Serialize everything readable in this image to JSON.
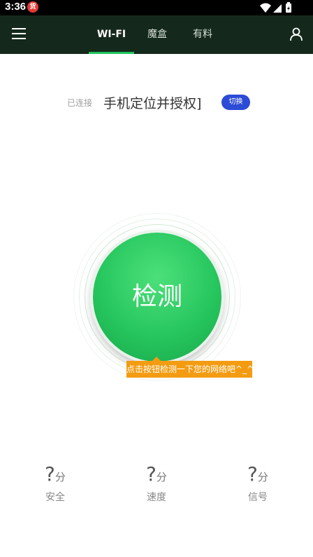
{
  "status_bar": {
    "time": "3:36",
    "badge_text": "货"
  },
  "app_bar": {
    "tabs": [
      {
        "label": "WI-FI",
        "active": true
      },
      {
        "label": "魔盒",
        "active": false
      },
      {
        "label": "有料",
        "active": false
      }
    ],
    "accent_color": "#22c55e"
  },
  "connection": {
    "status_label": "已连接",
    "ssid": "手机定位并授权]",
    "switch_label": "切换"
  },
  "detect": {
    "button_label": "检测",
    "tooltip": "点击按钮检测一下您的网络吧^_^"
  },
  "scores": [
    {
      "value": "?",
      "unit": "分",
      "label": "安全"
    },
    {
      "value": "?",
      "unit": "分",
      "label": "速度"
    },
    {
      "value": "?",
      "unit": "分",
      "label": "信号"
    }
  ]
}
